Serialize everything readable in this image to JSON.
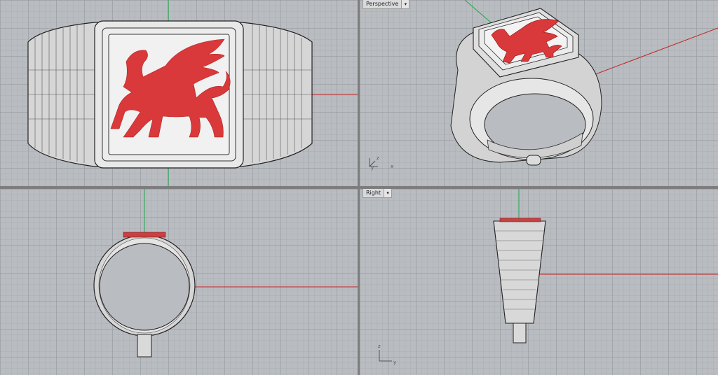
{
  "viewports": {
    "top": {
      "label": ""
    },
    "perspective": {
      "label": "Perspective"
    },
    "front": {
      "label": ""
    },
    "right": {
      "label": "Right"
    }
  },
  "axis_labels": {
    "perspective": {
      "z": "z",
      "y": "y",
      "x": "x"
    },
    "right": {
      "z": "z",
      "y": "y"
    }
  },
  "colors": {
    "background": "#b9bcc0",
    "x_axis": "#c02020",
    "y_axis": "#1fa84a",
    "model_fill": "#e4e4e4",
    "emblem": "#d9393a"
  },
  "icons": {
    "dropdown": "chevron-down-icon"
  }
}
